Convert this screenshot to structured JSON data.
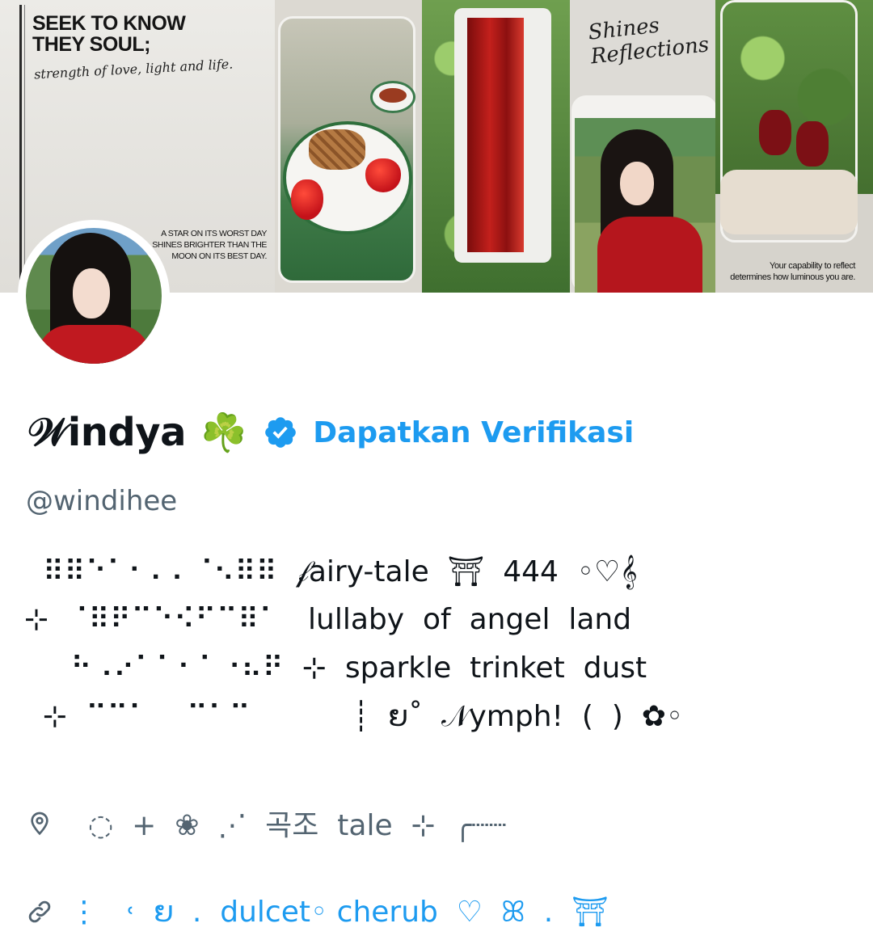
{
  "banner": {
    "headline": "SEEK TO KNOW THEY SOUL;",
    "headline_sub": "strength of love, light and life.",
    "star_quote": "A STAR ON ITS WORST DAY SHINES BRIGHTER THAN THE MOON ON ITS BEST DAY.",
    "shines_title_1": "Shines",
    "shines_title_2": "Reflections",
    "reflect_quote_1": "Your capability to reflect",
    "reflect_quote_2": "determines how luminous you are."
  },
  "profile": {
    "display_name": "𝒲indya",
    "clover": "☘️",
    "verification_label": "Dapatkan Verifikasi",
    "handle": "@windihee"
  },
  "bio": {
    "line1": "  ⠿⠿⠑⠁⠂⠄⠄⠈⠢⠿⠿  𝒻airy-tale  ⛩  444  ◦♡𝄞",
    "line2": "⊹  ⠈⠿⠟⠉⠑⠪⠋⠉⠿⠁   lullaby  of  angel  land",
    "line3": "     ⠓⠠⠔⠁⠁⠂⠁⠐⠦⠟  ⊹  sparkle  trinket  dust",
    "line4": "  ⊹  ⠉⠉⠁    ⠉⠁⠉           ┊  ຍ˚  𝒩ymph!  (  )  ✿◦"
  },
  "location": {
    "icon": "location-pin-icon",
    "text": "  ◌  +  ❀  ⋰  곡조  tale  ⊹  ╭┈┈"
  },
  "website": {
    "icon": "link-icon",
    "text": "⋮   ˓  ຍ  .  dulcet◦ cherub  ♡  ꕤ  .  ⛩"
  },
  "colors": {
    "accent": "#1d9bf0",
    "secondary_text": "#536471",
    "primary_text": "#0f1419",
    "background": "#ffffff"
  }
}
